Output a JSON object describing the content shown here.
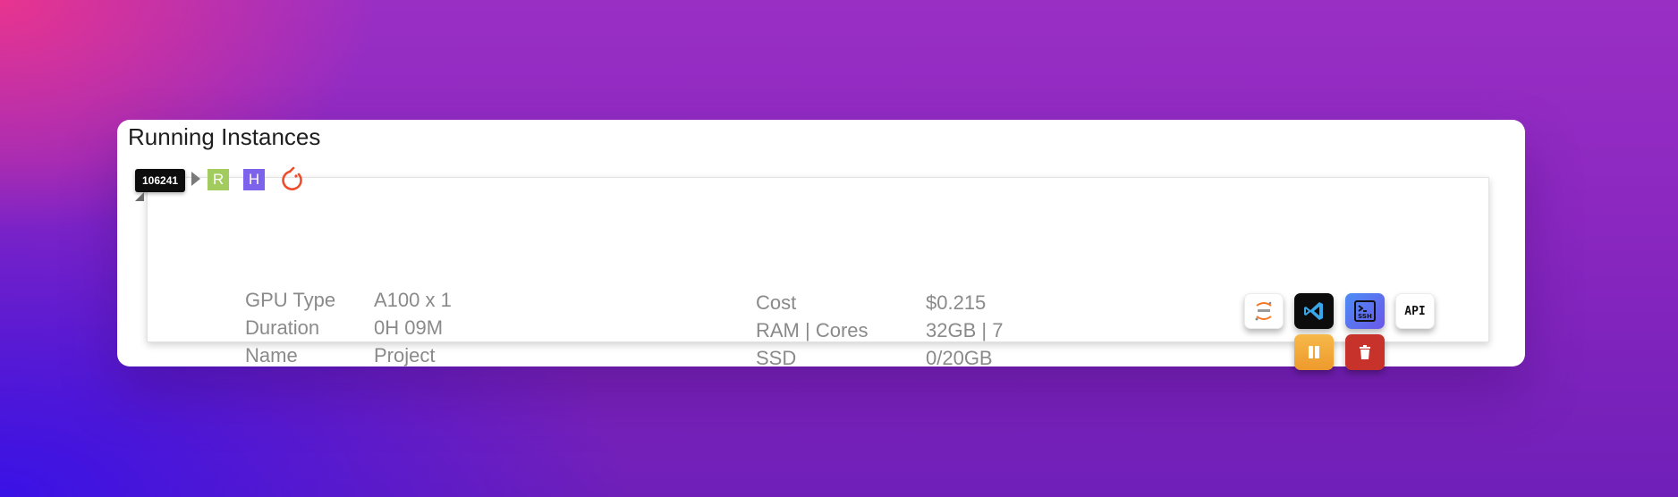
{
  "panel": {
    "title": "Running Instances"
  },
  "instance": {
    "id": "106241",
    "tags": [
      "R",
      "H"
    ],
    "framework_icon": "pytorch-icon",
    "left_details": [
      {
        "label": "GPU Type",
        "value": "A100 x 1"
      },
      {
        "label": "Duration",
        "value": "0H 09M"
      },
      {
        "label": "Name",
        "value": "Project"
      }
    ],
    "right_details": [
      {
        "label": "Cost",
        "value": "$0.215"
      },
      {
        "label": "RAM | Cores",
        "value": "32GB | 7"
      },
      {
        "label": "SSD",
        "value": "0/20GB"
      }
    ],
    "actions": {
      "jupyter_icon": "jupyter-icon",
      "vscode_icon": "vscode-icon",
      "ssh_label": "SSH",
      "api_label": "API",
      "pause_icon": "pause-icon",
      "delete_icon": "trash-icon"
    }
  },
  "colors": {
    "tag_r": "#a3cc5e",
    "tag_h": "#7d62ec",
    "pause": "#f0a636",
    "delete": "#c7322b",
    "pytorch": "#ee4c2c"
  }
}
